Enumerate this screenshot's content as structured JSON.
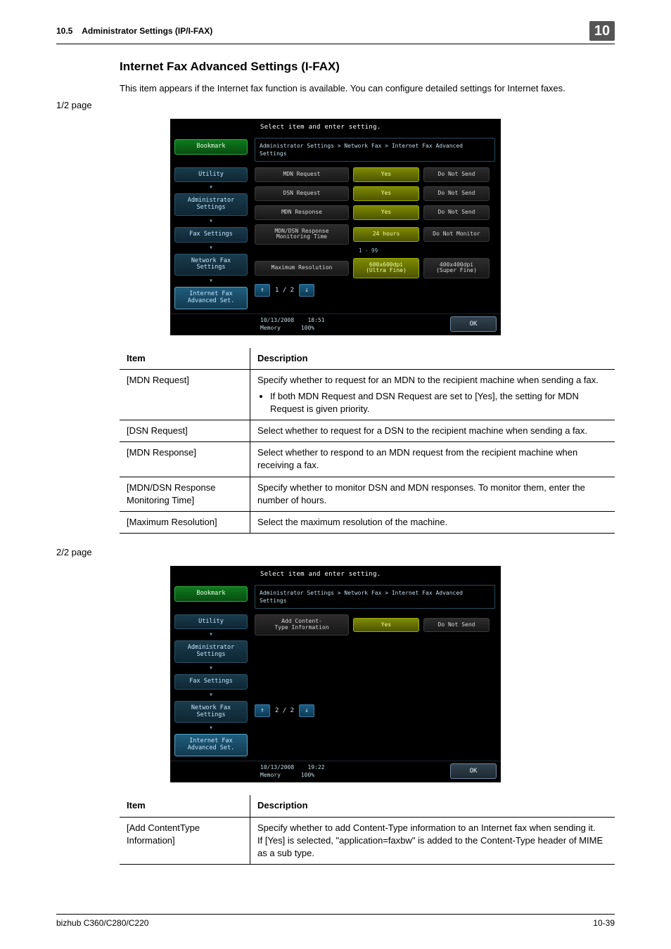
{
  "header": {
    "section": "10.5",
    "title": "Administrator Settings (IP/I-FAX)",
    "chapter": "10"
  },
  "heading": "Internet Fax Advanced Settings (I-FAX)",
  "intro": "This item appears if the Internet fax function is available. You can configure detailed settings for Internet faxes.",
  "page1": {
    "label": "1/2 page",
    "panel": {
      "prompt": "Select item and enter setting.",
      "bookmark": "Bookmark",
      "crumbs": [
        "Utility",
        "Administrator Settings",
        "Fax Settings",
        "Network Fax Settings",
        "Internet Fax Advanced Set."
      ],
      "breadcrumb": "Administrator Settings > Network Fax > Internet Fax Advanced Settings",
      "rows": [
        {
          "label": "MDN Request",
          "opt1": "Yes",
          "opt2": "Do Not Send"
        },
        {
          "label": "DSN Request",
          "opt1": "Yes",
          "opt2": "Do Not Send"
        },
        {
          "label": "MDN Response",
          "opt1": "Yes",
          "opt2": "Do Not Send"
        },
        {
          "label": "MDN/DSN Response\nMonitoring Time",
          "opt1": "24   hours",
          "opt2": "Do Not Monitor"
        },
        {
          "label": "Maximum Resolution",
          "opt1": "600x600dpi\n(Ultra Fine)",
          "opt2": "400x400dpi\n(Super Fine)"
        }
      ],
      "range": "1 - 99",
      "pager": "1 / 2",
      "date": "10/13/2008",
      "time": "18:51",
      "memory": "Memory",
      "memval": "100%",
      "ok": "OK"
    },
    "table": {
      "h1": "Item",
      "h2": "Description",
      "rows": [
        {
          "item": "[MDN Request]",
          "desc": "Specify whether to request for an MDN to the recipient machine when sending a fax.",
          "bullet": "If both MDN Request and DSN Request are set to [Yes], the setting for MDN Request is given priority."
        },
        {
          "item": "[DSN Request]",
          "desc": "Select whether to request for a DSN to the recipient machine when sending a fax."
        },
        {
          "item": "[MDN Response]",
          "desc": "Select whether to respond to an MDN request from the recipient machine when receiving a fax."
        },
        {
          "item": "[MDN/DSN Response Monitoring Time]",
          "desc": "Specify whether to monitor DSN and MDN responses. To monitor them, enter the number of hours."
        },
        {
          "item": "[Maximum Resolution]",
          "desc": "Select the maximum resolution of the machine."
        }
      ]
    }
  },
  "page2": {
    "label": "2/2 page",
    "panel": {
      "prompt": "Select item and enter setting.",
      "bookmark": "Bookmark",
      "crumbs": [
        "Utility",
        "Administrator Settings",
        "Fax Settings",
        "Network Fax Settings",
        "Internet Fax Advanced Set."
      ],
      "breadcrumb": "Administrator Settings > Network Fax > Internet Fax Advanced Settings",
      "row": {
        "label": "Add Content-\nType Information",
        "opt1": "Yes",
        "opt2": "Do Not Send"
      },
      "pager": "2 / 2",
      "date": "10/13/2008",
      "time": "19:22",
      "memory": "Memory",
      "memval": "100%",
      "ok": "OK"
    },
    "table": {
      "h1": "Item",
      "h2": "Description",
      "row": {
        "item": "[Add ContentType Information]",
        "desc": "Specify whether to add Content-Type information to an Internet fax when sending it.\nIf [Yes] is selected, \"application=faxbw\" is added to the Content-Type header of MIME as a sub type."
      }
    }
  },
  "footer": {
    "model": "bizhub C360/C280/C220",
    "page": "10-39"
  }
}
